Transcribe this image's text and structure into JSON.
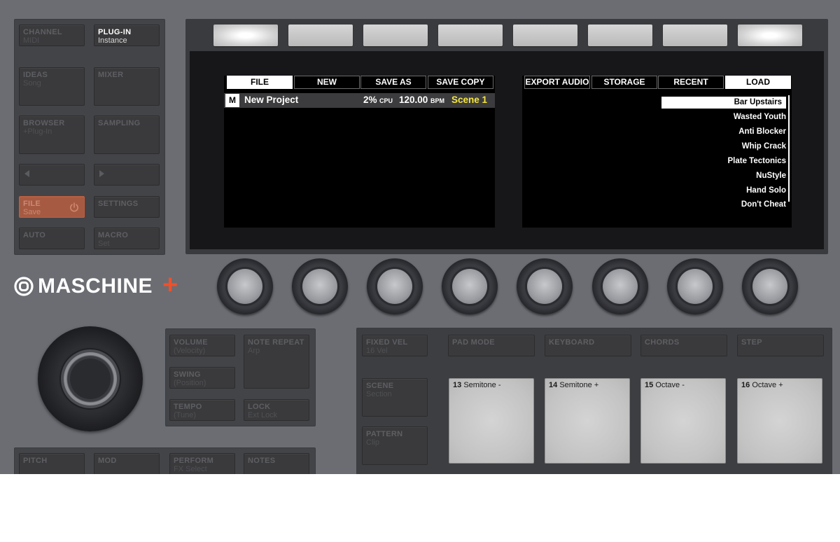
{
  "left_buttons": {
    "channel": {
      "title": "CHANNEL",
      "sub": "MIDI"
    },
    "plugin": {
      "title": "PLUG-IN",
      "sub": "Instance"
    },
    "ideas": {
      "title": "IDEAS",
      "sub": "Song"
    },
    "mixer": {
      "title": "MIXER",
      "sub": ""
    },
    "browser": {
      "title": "BROWSER",
      "sub": "+Plug-In"
    },
    "sampling": {
      "title": "SAMPLING",
      "sub": ""
    },
    "file": {
      "title": "FILE",
      "sub": "Save"
    },
    "settings": {
      "title": "SETTINGS",
      "sub": ""
    },
    "auto": {
      "title": "AUTO",
      "sub": ""
    },
    "macro": {
      "title": "MACRO",
      "sub": "Set"
    }
  },
  "brand": {
    "name": "MASCHINE",
    "plus": "+"
  },
  "screen_left": {
    "tabs": [
      "FILE",
      "NEW",
      "SAVE AS",
      "SAVE COPY"
    ],
    "selected_tab": 0,
    "mode_badge": "M",
    "project_name": "New Project",
    "cpu_value": "2%",
    "cpu_label": "CPU",
    "bpm_value": "120.00",
    "bpm_label": "BPM",
    "scene": "Scene 1"
  },
  "screen_right": {
    "tabs": [
      "EXPORT AUDIO",
      "STORAGE",
      "RECENT",
      "LOAD"
    ],
    "selected_tab": 3,
    "items": [
      "Bar Upstairs",
      "Wasted Youth",
      "Anti Blocker",
      "Whip Crack",
      "Plate Tectonics",
      "NuStyle",
      "Hand Solo",
      "Don't Cheat"
    ],
    "selected_item": 0
  },
  "mid_buttons": {
    "volume": {
      "title": "VOLUME",
      "sub": "(Velocity)"
    },
    "note_repeat": {
      "title": "NOTE REPEAT",
      "sub": "Arp"
    },
    "swing": {
      "title": "SWING",
      "sub": "(Position)"
    },
    "tempo": {
      "title": "TEMPO",
      "sub": "(Tune)"
    },
    "lock": {
      "title": "LOCK",
      "sub": "Ext Lock"
    }
  },
  "bottom_buttons": {
    "pitch": {
      "title": "PITCH",
      "sub": ""
    },
    "mod": {
      "title": "MOD",
      "sub": ""
    },
    "perform": {
      "title": "PERFORM",
      "sub": "FX Select"
    },
    "notes": {
      "title": "NOTES",
      "sub": ""
    }
  },
  "pad_section": {
    "fixed_vel": {
      "title": "FIXED VEL",
      "sub": "16 Vel"
    },
    "pad_mode": {
      "title": "PAD MODE"
    },
    "keyboard": {
      "title": "KEYBOARD"
    },
    "chords": {
      "title": "CHORDS"
    },
    "step": {
      "title": "STEP"
    },
    "scene": {
      "title": "SCENE",
      "sub": "Section"
    },
    "pattern": {
      "title": "PATTERN",
      "sub": "Clip"
    },
    "pads": [
      {
        "num": "13",
        "label": "Semitone -"
      },
      {
        "num": "14",
        "label": "Semitone +"
      },
      {
        "num": "15",
        "label": "Octave -"
      },
      {
        "num": "16",
        "label": "Octave +"
      }
    ]
  },
  "colors": {
    "accent": "#f0502a",
    "scene_yellow": "#f6e63c",
    "body": "#6b6d73",
    "file_button": "#a65a42"
  }
}
